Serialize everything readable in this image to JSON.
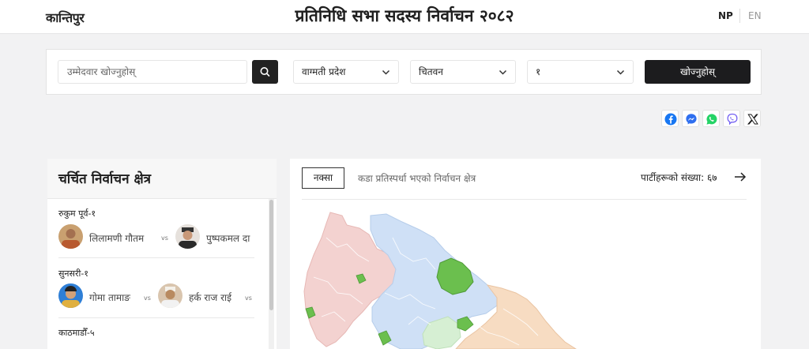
{
  "header": {
    "logo": "कान्तिपुर",
    "title": "प्रतिनिधि सभा सदस्य निर्वाचन २०८२",
    "lang_np": "NP",
    "lang_en": "EN"
  },
  "search": {
    "placeholder": "उम्मेदवार खोज्नुहोस्",
    "province": "वाग्मती प्रदेश",
    "district": "चितवन",
    "constituency": "१",
    "find_label": "खोज्नुहोस्"
  },
  "share_icons": [
    "facebook-icon",
    "messenger-icon",
    "whatsapp-icon",
    "viber-icon",
    "x-icon"
  ],
  "sidebar": {
    "title": "चर्चित निर्वाचन क्षेत्र",
    "vs_label": "vs",
    "items": [
      {
        "constituency": "रुकुम पूर्व-१",
        "candidates": [
          "लिलामणी गौतम",
          "पुष्पकमल दा"
        ]
      },
      {
        "constituency": "सुनसरी-१",
        "candidates": [
          "गोमा तामाङ",
          "हर्क राज राई"
        ]
      },
      {
        "constituency": "काठमाडौँ-५",
        "candidates": []
      }
    ]
  },
  "main": {
    "tab_map": "नक्सा",
    "tab_close": "कडा प्रतिस्पर्धा भएको निर्वाचन क्षेत्र",
    "party_count": "पार्टीहरूको संख्या: ६७"
  },
  "colors": {
    "province_red": "#f3d2d0",
    "province_blue": "#cfe0f6",
    "province_orange": "#f7dcc2",
    "province_green": "#d6efd3",
    "highlight_green": "#6bbf4e"
  }
}
